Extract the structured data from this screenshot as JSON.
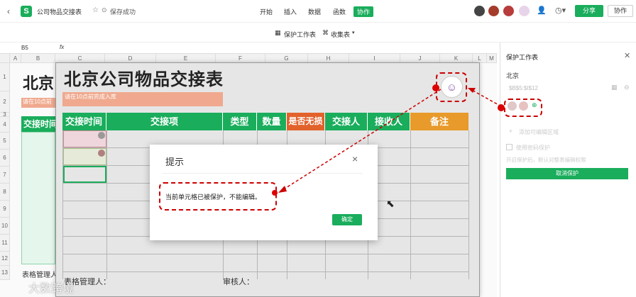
{
  "app": {
    "title": "公司物品交接表",
    "save_status": "保存成功",
    "logo": "S"
  },
  "menu": [
    "开始",
    "插入",
    "数据",
    "函数",
    "协作"
  ],
  "toolbar": {
    "protect": "保护工作表",
    "collect": "收集表"
  },
  "top_buttons": {
    "share": "分享",
    "collab": "协作"
  },
  "formula": {
    "cell": "B5",
    "fx": "fx"
  },
  "columns": [
    "A",
    "B",
    "C",
    "D",
    "E",
    "F",
    "G",
    "H",
    "I",
    "J",
    "K",
    "L",
    "M"
  ],
  "rows": [
    "1",
    "2",
    "3",
    "4",
    "5",
    "6",
    "7",
    "8",
    "9",
    "10",
    "11",
    "12",
    "13"
  ],
  "bg_sheet": {
    "title": "北京",
    "subtitle": "请在10点前",
    "header": "交接时间",
    "footer": "表格管理人"
  },
  "sheet": {
    "title": "北京公司物品交接表",
    "subtitle": "请在10点前完成入库",
    "headers": [
      "交接时间",
      "交接项",
      "类型",
      "数量",
      "是否无损",
      "交接人",
      "接收人",
      "备注"
    ],
    "footer_left": "表格管理人：",
    "footer_right": "审核人："
  },
  "panel": {
    "title": "保护工作表",
    "subtitle": "北京",
    "range": "$B$5:$I$12",
    "add_area": "添加可编辑区域",
    "use_password": "使用密码保护",
    "hint": "开启保护后，默认对整表编辑权限",
    "cancel": "取消保护"
  },
  "dialog": {
    "title": "提示",
    "message": "当前单元格已被保护，不能编辑。",
    "ok": "确定",
    "close": "×"
  },
  "watermark": "大数跨境",
  "colors": {
    "accent": "#1aad5c",
    "warning": "#e2622c",
    "note": "#e89a2a",
    "alert": "#cc0000"
  }
}
